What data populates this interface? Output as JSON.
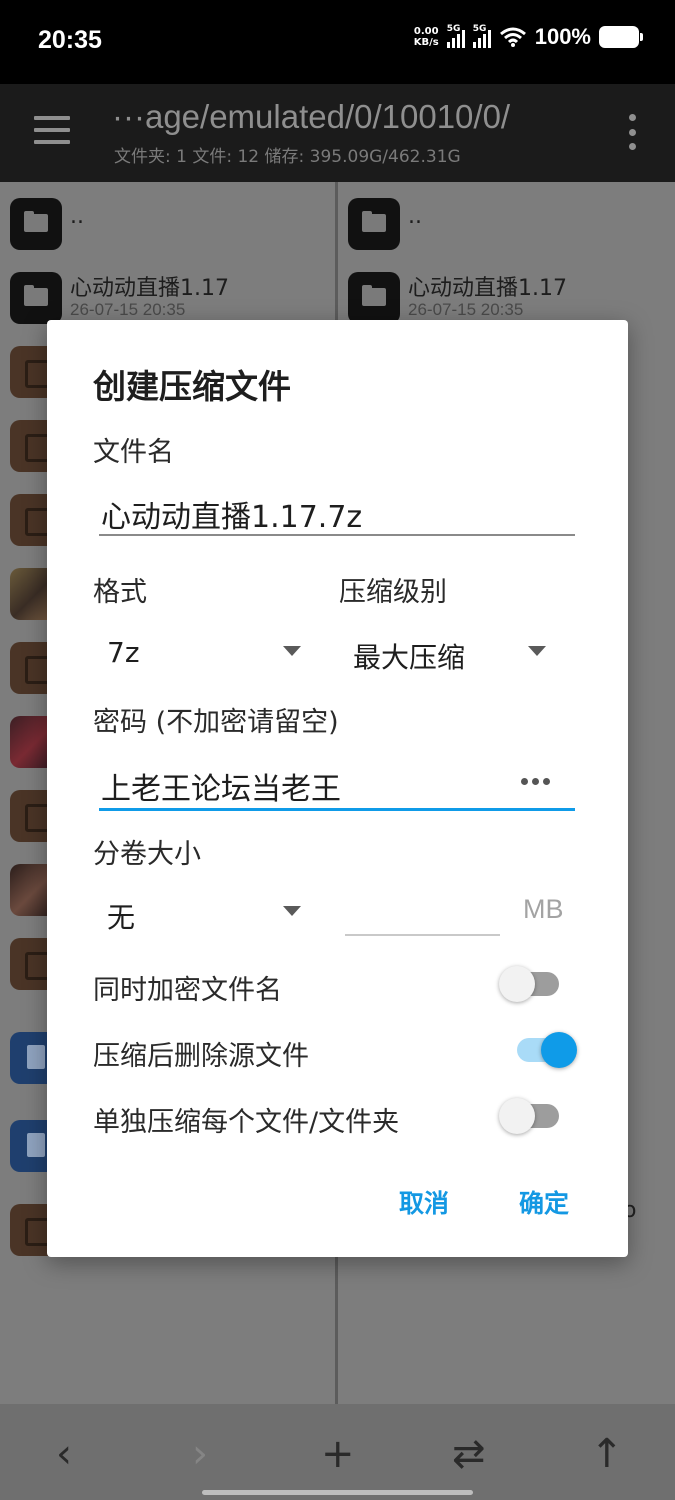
{
  "status": {
    "time": "20:35",
    "netspeed_value": "0.00",
    "netspeed_unit": "KB/s",
    "sim1": "5G",
    "sim2": "5G",
    "battery": "100%"
  },
  "appbar": {
    "path": "···age/emulated/0/10010/0/",
    "info": "文件夹: 1  文件: 12  储存: 395.09G/462.31G"
  },
  "left_pane": {
    "items": [
      {
        "name": "..",
        "date": ""
      },
      {
        "name": "心动动直播1.17",
        "date": "26-07-15 20:35"
      }
    ]
  },
  "right_pane": {
    "items": [
      {
        "name": "..",
        "date": ""
      },
      {
        "name": "心动动直播1.17",
        "date": "26-07-15 20:35"
      }
    ],
    "stray_text": "o"
  },
  "dialog": {
    "title": "创建压缩文件",
    "filename_label": "文件名",
    "filename_value": "心动动直播1.17.7z",
    "format_label": "格式",
    "format_value": "7z",
    "level_label": "压缩级别",
    "level_value": "最大压缩",
    "password_label": "密码 (不加密请留空)",
    "password_value": "上老王论坛当老王",
    "volume_label": "分卷大小",
    "volume_value": "无",
    "volume_unit": "MB",
    "encrypt_names_label": "同时加密文件名",
    "encrypt_names_on": false,
    "delete_source_label": "压缩后删除源文件",
    "delete_source_on": true,
    "each_separately_label": "单独压缩每个文件/文件夹",
    "each_separately_on": false,
    "cancel": "取消",
    "ok": "确定",
    "accent": "#0f9be8"
  },
  "bottom_nav": {
    "back": "‹",
    "forward": "›",
    "add": "+",
    "swap": "⇄",
    "up": "↑"
  }
}
